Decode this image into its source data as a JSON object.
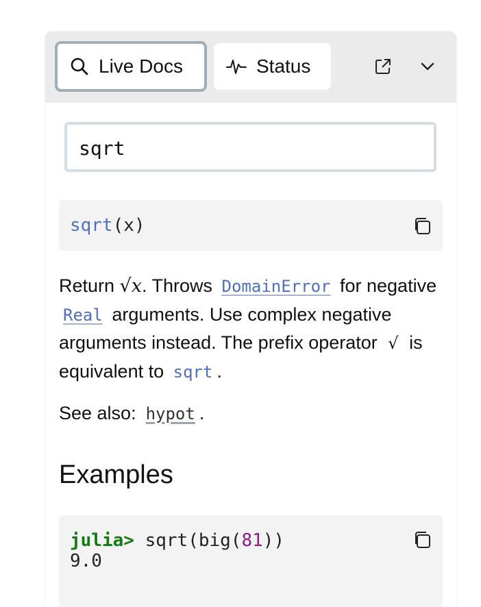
{
  "tabs": {
    "live_docs": "Live Docs",
    "status": "Status"
  },
  "search": {
    "value": "sqrt"
  },
  "signature": {
    "func": "sqrt",
    "args": "(x)"
  },
  "doc": {
    "p1_return": "Return ",
    "p1_math": "√x",
    "p1_throws": ". Throws",
    "p1_domain_error": "DomainError",
    "p1_for": "for negative",
    "p1_real": "Real",
    "p1_rest": "arguments. Use complex negative arguments instead. The prefix operator",
    "p1_radical": "√",
    "p1_equiv": "is equivalent to",
    "p1_sqrt": "sqrt",
    "p1_end": "."
  },
  "see_also": {
    "label": "See also:",
    "ref": "hypot",
    "end": "."
  },
  "examples": {
    "heading": "Examples",
    "prompt": "julia>",
    "code_pre": " sqrt(big(",
    "code_num": "81",
    "code_post": "))",
    "output": "9.0"
  },
  "colors": {
    "accent_link": "#4f6fbf",
    "julia_prompt": "#147a14",
    "number": "#8b1a8b"
  }
}
